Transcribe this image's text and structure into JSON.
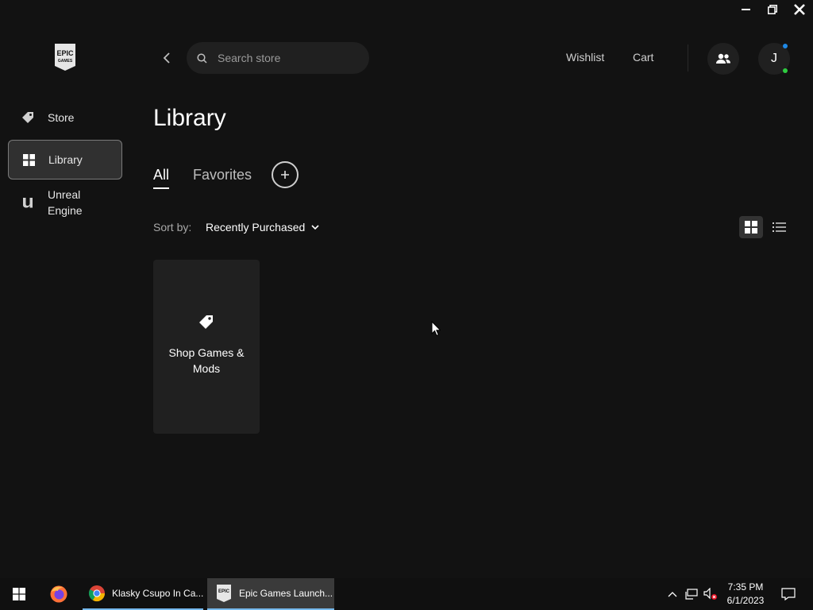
{
  "window": {
    "controls": [
      "minimize",
      "restore",
      "close"
    ]
  },
  "sidebar": {
    "logo": {
      "line1": "EPIC",
      "line2": "GAMES"
    },
    "items": [
      {
        "label": "Store",
        "icon": "tag-icon",
        "active": false
      },
      {
        "label": "Library",
        "icon": "grid-icon",
        "active": true
      },
      {
        "label": "Unreal\nEngine",
        "icon": "unreal-icon",
        "active": false
      }
    ]
  },
  "header": {
    "search_placeholder": "Search store",
    "wishlist": "Wishlist",
    "cart": "Cart",
    "avatar_initial": "J"
  },
  "library": {
    "title": "Library",
    "tabs": [
      {
        "label": "All",
        "active": true
      },
      {
        "label": "Favorites",
        "active": false
      }
    ],
    "sort_label": "Sort by:",
    "sort_value": "Recently Purchased",
    "view_mode": "grid",
    "cards": [
      {
        "label": "Shop Games & Mods",
        "icon": "tag-icon"
      }
    ]
  },
  "taskbar": {
    "apps": [
      {
        "label": "Klasky Csupo In Ca...",
        "icon": "chrome-icon"
      },
      {
        "label": "Epic Games Launch...",
        "icon": "epic-icon",
        "active": true
      }
    ],
    "clock": {
      "time": "7:35 PM",
      "date": "6/1/2023"
    }
  },
  "colors": {
    "background": "#121212",
    "panel": "#202020",
    "active_nav": "#303030",
    "taskbar_accent": "#76b9ed"
  }
}
